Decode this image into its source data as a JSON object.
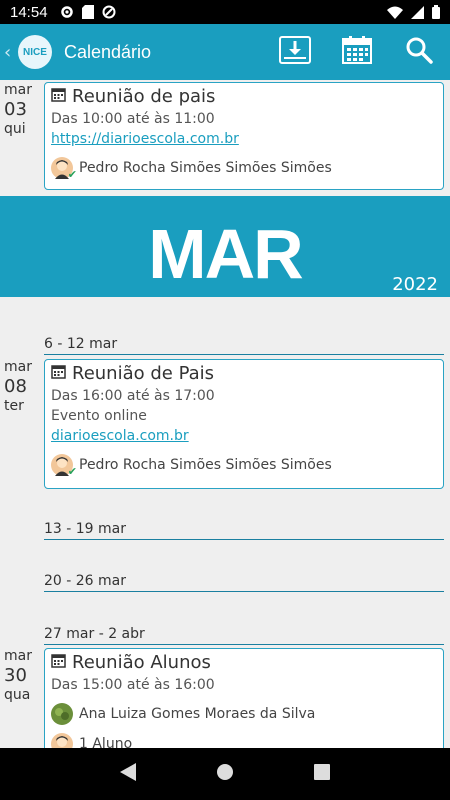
{
  "status": {
    "time": "14:54"
  },
  "app_bar": {
    "logo_text": "NICE",
    "title": "Calendário",
    "icons": [
      "back-chevron-icon",
      "download-icon",
      "calendar-icon",
      "search-icon"
    ]
  },
  "events": [
    {
      "date": {
        "month": "mar",
        "day": "03",
        "weekday": "qui"
      },
      "title": "Reunião de pais",
      "time": "Das 10:00 até às 11:00",
      "link": "https://diarioescola.com.br",
      "person": "Pedro Rocha Simões Simões Simões"
    },
    {
      "date": {
        "month": "mar",
        "day": "08",
        "weekday": "ter"
      },
      "title": "Reunião de Pais",
      "time": "Das 16:00 até às 17:00",
      "note": "Evento online",
      "link": "diarioescola.com.br",
      "person": "Pedro Rocha Simões Simões Simões"
    },
    {
      "date": {
        "month": "mar",
        "day": "30",
        "weekday": "qua"
      },
      "title": "Reunião Alunos",
      "time": "Das 15:00 até às 16:00",
      "person": "Ana Luiza Gomes Moraes da Silva",
      "person2": "1 Aluno"
    }
  ],
  "month_banner": {
    "month": "MAR",
    "year": "2022"
  },
  "weeks": [
    "6 - 12 mar",
    "13 - 19 mar",
    "20 - 26 mar",
    "27 mar - 2 abr"
  ],
  "colors": {
    "primary": "#1a9ebf",
    "background": "#efefef",
    "check": "#28a05a"
  }
}
